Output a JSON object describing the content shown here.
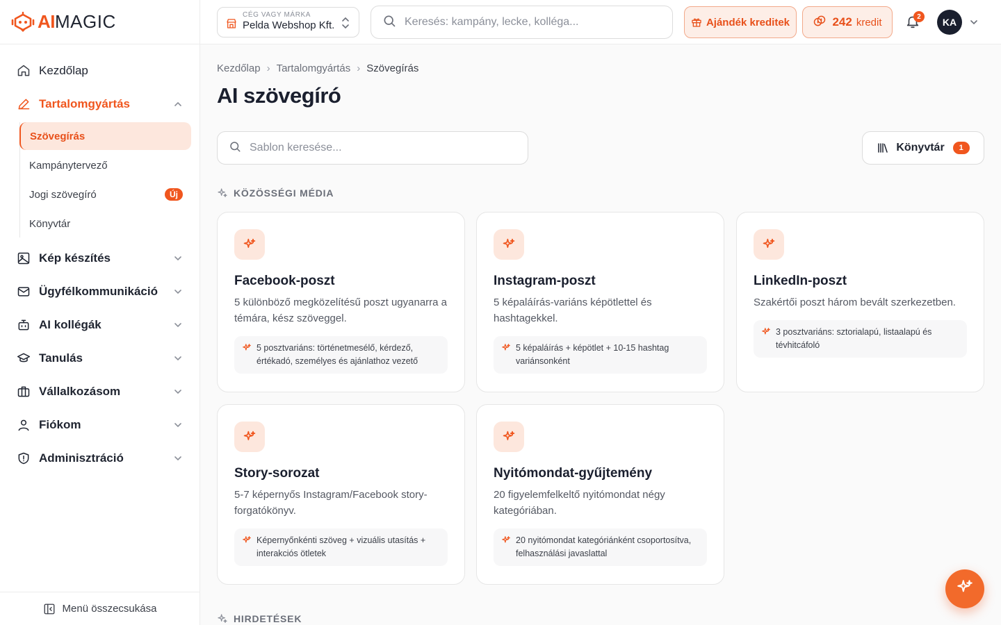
{
  "brand": {
    "logo_ai": "AI",
    "logo_magic": "MAGIC"
  },
  "sidebar": {
    "items": [
      {
        "label": "Kezdőlap"
      },
      {
        "label": "Tartalomgyártás"
      },
      {
        "label": "Kép készítés"
      },
      {
        "label": "Ügyfélkommunikáció"
      },
      {
        "label": "AI kollégák"
      },
      {
        "label": "Tanulás"
      },
      {
        "label": "Vállalkozásom"
      },
      {
        "label": "Fiókom"
      },
      {
        "label": "Adminisztráció"
      }
    ],
    "sub_items": [
      {
        "label": "Szövegírás"
      },
      {
        "label": "Kampánytervező"
      },
      {
        "label": "Jogi szövegíró",
        "badge": "Új"
      },
      {
        "label": "Könyvtár"
      }
    ],
    "collapse_label": "Menü összecsukása"
  },
  "header": {
    "brand_caption": "CÉG VAGY MÁRKA",
    "brand_value": "Pelda Webshop Kft.",
    "search_placeholder": "Keresés: kampány, lecke, kolléga...",
    "gift_label": "Ajándék kreditek",
    "credits_value": "242",
    "credits_unit": "kredit",
    "notifications_count": "2",
    "avatar_initials": "KA"
  },
  "main": {
    "breadcrumb": [
      "Kezdőlap",
      "Tartalomgyártás",
      "Szövegírás"
    ],
    "title": "AI szövegíró",
    "template_search_placeholder": "Sablon keresése...",
    "library_label": "Könyvtár",
    "library_count": "1",
    "sections": [
      {
        "label": "KÖZÖSSÉGI MÉDIA"
      },
      {
        "label": "HIRDETÉSEK"
      }
    ],
    "cards": [
      {
        "title": "Facebook-poszt",
        "desc": "5 különböző megközelítésű poszt ugyanarra a témára, kész szöveggel.",
        "note": "5 posztvariáns: történetmesélő, kérdező, értékadó, személyes és ajánlathoz vezető"
      },
      {
        "title": "Instagram-poszt",
        "desc": "5 képaláírás-variáns képötlettel és hashtagekkel.",
        "note": "5 képaláírás + képötlet + 10-15 hashtag variánsonként"
      },
      {
        "title": "LinkedIn-poszt",
        "desc": "Szakértői poszt három bevált szerkezetben.",
        "note": "3 posztvariáns: sztorialapú, listaalapú és tévhitcáfoló"
      },
      {
        "title": "Story-sorozat",
        "desc": "5-7 képernyős Instagram/Facebook story-forgatókönyv.",
        "note": "Képernyőnkénti szöveg + vizuális utasítás + interakciós ötletek"
      },
      {
        "title": "Nyitómondat-gyűjtemény",
        "desc": "20 figyelemfelkeltő nyitómondat négy kategóriában.",
        "note": "20 nyitómondat kategóriánként csoportosítva, felhasználási javaslattal"
      }
    ]
  },
  "colors": {
    "accent": "#f0561e",
    "accent_soft": "#fde7dd",
    "dark": "#1a1f2e"
  }
}
